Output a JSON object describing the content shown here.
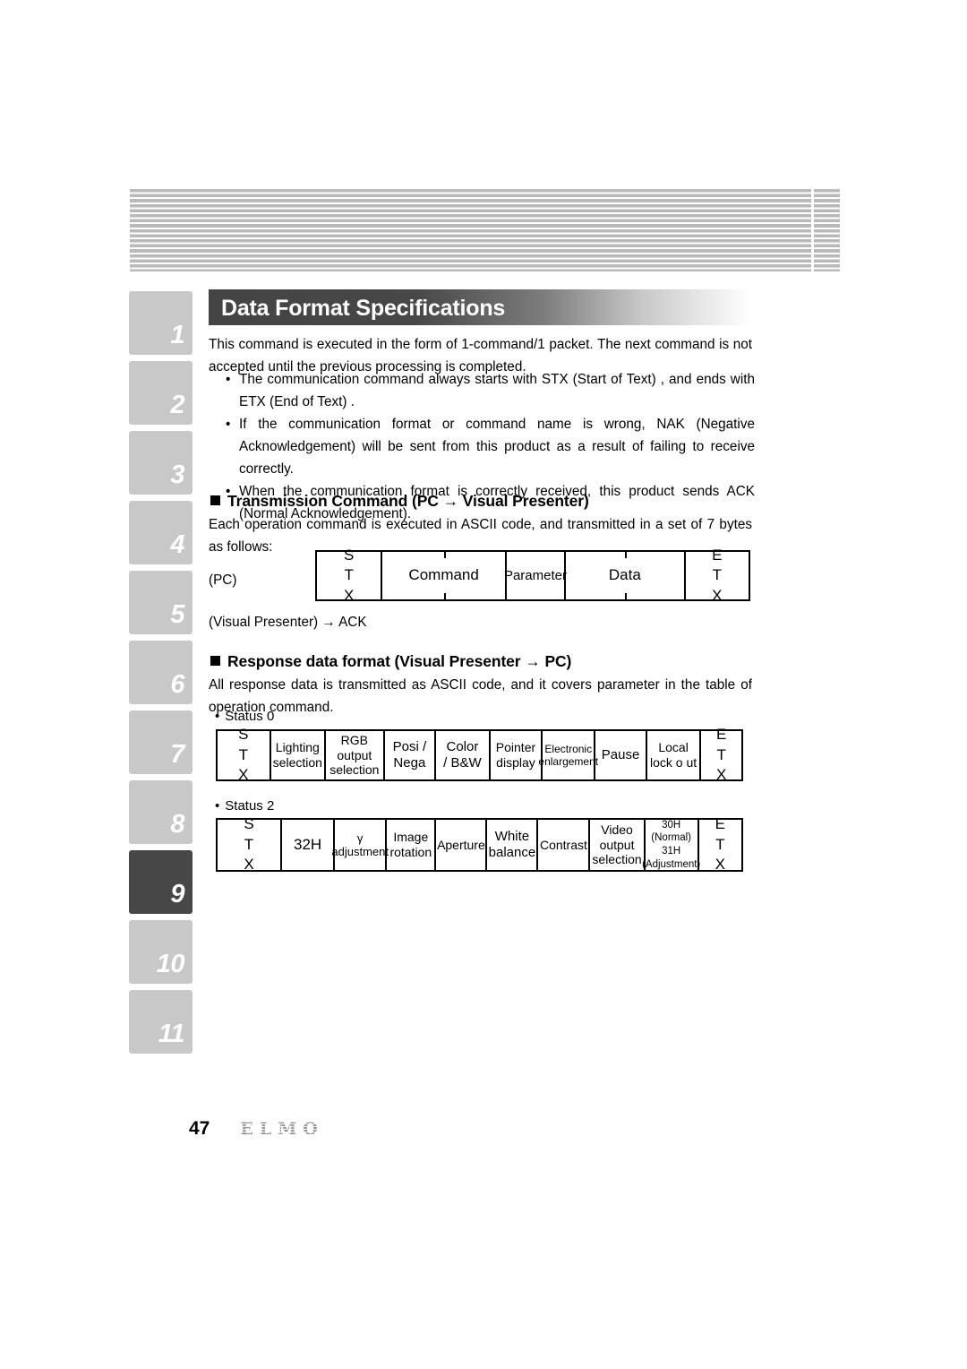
{
  "side_tabs": {
    "items": [
      {
        "label": "1",
        "active": false
      },
      {
        "label": "2",
        "active": false
      },
      {
        "label": "3",
        "active": false
      },
      {
        "label": "4",
        "active": false
      },
      {
        "label": "5",
        "active": false
      },
      {
        "label": "6",
        "active": false
      },
      {
        "label": "7",
        "active": false
      },
      {
        "label": "8",
        "active": false
      },
      {
        "label": "9",
        "active": true
      },
      {
        "label": "10",
        "active": false
      },
      {
        "label": "11",
        "active": false
      }
    ]
  },
  "section": {
    "title": "Data Format Specifications",
    "intro": "This command is executed in the form of 1-command/1 packet.  The next command is not accepted until the previous processing is completed.",
    "bullets": [
      "The communication command always starts with STX (Start of Text) , and ends with ETX (End of Text) .",
      "If the communication format or command name is wrong, NAK (Negative Acknowledgement) will be sent from this product as a result of failing to receive correctly.",
      "When the communication format is correctly received, this product sends ACK (Normal Acknowledgement)."
    ]
  },
  "transmission": {
    "heading": "Transmission Command (PC → Visual Presenter)",
    "description": "Each operation command is executed in ASCII code, and transmitted in a set of 7 bytes as follows:",
    "pc_label": "(PC)",
    "response_line": "(Visual Presenter)    →    ACK",
    "cells": [
      {
        "lines": [
          "S",
          "T",
          "X"
        ],
        "type": "stx"
      },
      {
        "lines": [
          "Command"
        ],
        "ticks": true
      },
      {
        "lines": [
          "Parameter"
        ]
      },
      {
        "lines": [
          "Data"
        ],
        "ticks": true
      },
      {
        "lines": [
          "E",
          "T",
          "X"
        ],
        "type": "etx"
      }
    ]
  },
  "response": {
    "heading": "Response data format (Visual Presenter → PC)",
    "description": "All response data is transmitted as ASCII code, and it covers parameter in the table of operation command.",
    "status0_label": "Status 0",
    "status0_cells": [
      {
        "lines": [
          "S",
          "T",
          "X"
        ],
        "type": "stx"
      },
      {
        "lines": [
          "Lighting",
          "selection"
        ]
      },
      {
        "lines": [
          "RGB",
          "output",
          "selection"
        ]
      },
      {
        "lines": [
          "Posi /",
          "Nega"
        ]
      },
      {
        "lines": [
          "Color",
          "/   B&W"
        ]
      },
      {
        "lines": [
          "Pointer",
          "display"
        ]
      },
      {
        "lines": [
          "Electronic",
          "enlargement"
        ],
        "small": true
      },
      {
        "lines": [
          "Pause"
        ]
      },
      {
        "lines": [
          "Local",
          "lock o ut"
        ]
      },
      {
        "lines": [
          "E",
          "T",
          "X"
        ],
        "type": "etx"
      }
    ],
    "status2_label": "Status 2",
    "status2_cells": [
      {
        "lines": [
          "S",
          "T",
          "X"
        ],
        "type": "stx"
      },
      {
        "lines": [
          "32H"
        ]
      },
      {
        "lines": [
          "γ",
          "adjustment"
        ]
      },
      {
        "lines": [
          "Image",
          "rotation"
        ]
      },
      {
        "lines": [
          "Aperture"
        ]
      },
      {
        "lines": [
          "White",
          "balance"
        ]
      },
      {
        "lines": [
          "Contrast"
        ]
      },
      {
        "lines": [
          "Video",
          "output",
          "selection"
        ]
      },
      {
        "lines": [
          "30H",
          "(Normal)",
          "31H",
          "(Adjustment)"
        ],
        "small": true
      },
      {
        "lines": [
          "E",
          "T",
          "X"
        ],
        "type": "etx"
      }
    ]
  },
  "footer": {
    "page_number": "47",
    "brand": "ELMO"
  }
}
